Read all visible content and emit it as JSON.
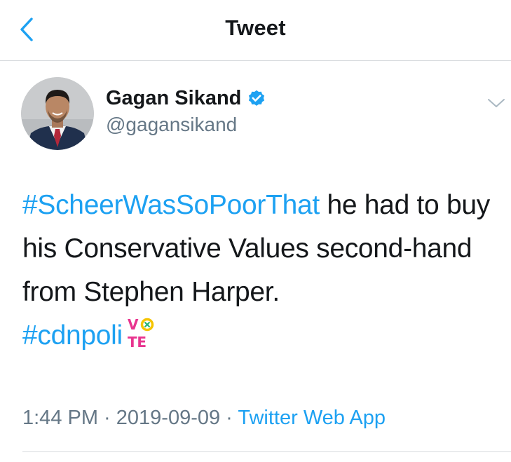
{
  "header": {
    "title": "Tweet",
    "back_icon": "chevron-left-icon"
  },
  "author": {
    "name": "Gagan Sikand",
    "handle": "@gagansikand",
    "verified": true,
    "verified_icon": "verified-badge-icon"
  },
  "tweet": {
    "text_parts": [
      {
        "type": "hashtag",
        "text": "#ScheerWasSoPoorThat"
      },
      {
        "type": "text",
        "text": " he had to buy his Conservative Values second-hand from Stephen Harper."
      },
      {
        "type": "hashtag",
        "text": "#cdnpoli"
      }
    ],
    "emoji": {
      "name": "vote-hashflag-icon",
      "line1": "VO",
      "line2": "TE"
    }
  },
  "meta": {
    "time": "1:44 PM",
    "separator": " · ",
    "date": "2019-09-09",
    "app": "Twitter Web App"
  },
  "colors": {
    "link": "#1da1f2",
    "text": "#14171a",
    "secondary": "#657786",
    "divider": "#d6dadd",
    "vote_yellow": "#f5c400",
    "vote_pink": "#e8358f"
  }
}
